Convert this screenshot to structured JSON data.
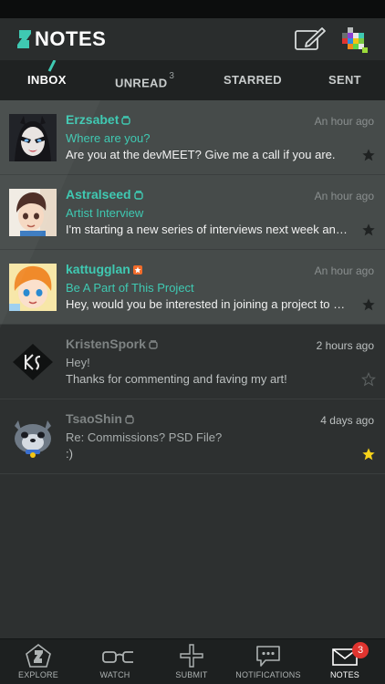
{
  "app": {
    "title": "NOTES",
    "brand_color": "#3fc9b2"
  },
  "appbar": {
    "compose_icon": "compose-note-icon",
    "user_avatar": "user-avatar"
  },
  "tabs": [
    {
      "label": "INBOX",
      "active": true
    },
    {
      "label": "UNREAD",
      "count": "3"
    },
    {
      "label": "STARRED"
    },
    {
      "label": "SENT"
    }
  ],
  "notes": [
    {
      "sender": "Erzsabet",
      "time": "An hour ago",
      "subject": "Where are you?",
      "preview": "Are you at the devMEET? Give me a call if you are.",
      "unread": true,
      "starred": false
    },
    {
      "sender": "Astralseed",
      "time": "An hour ago",
      "subject": "Artist Interview",
      "preview": "I'm starting a new series of interviews next week and a...",
      "unread": true,
      "starred": false
    },
    {
      "sender": "kattugglan",
      "time": "An hour ago",
      "subject": "Be A Part of This Project",
      "preview": "Hey, would you be interested in joining a project to pro...",
      "unread": true,
      "starred": false
    },
    {
      "sender": "KristenSpork",
      "time": "2 hours ago",
      "subject": "Hey!",
      "preview": "Thanks for commenting and faving my art!",
      "unread": false,
      "starred": false
    },
    {
      "sender": "TsaoShin",
      "time": "4 days ago",
      "subject": "Re: Commissions? PSD File?",
      "preview": ":)",
      "unread": false,
      "starred": true
    }
  ],
  "bottom_nav": [
    {
      "label": "EXPLORE",
      "icon": "explore-icon"
    },
    {
      "label": "WATCH",
      "icon": "watch-glasses-icon"
    },
    {
      "label": "SUBMIT",
      "icon": "plus-icon"
    },
    {
      "label": "NOTIFICATIONS",
      "icon": "speech-bubble-icon"
    },
    {
      "label": "NOTES",
      "icon": "envelope-icon",
      "badge": "3",
      "active": true
    }
  ]
}
